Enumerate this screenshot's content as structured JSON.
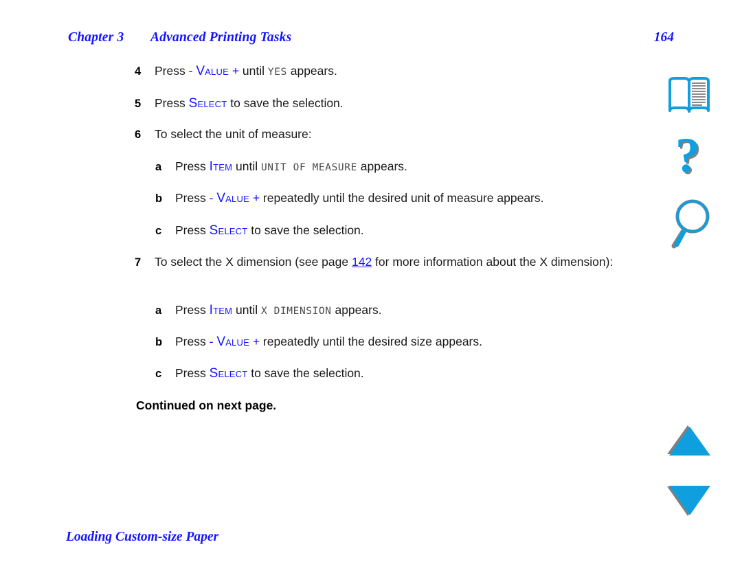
{
  "header": {
    "chapter": "Chapter 3",
    "title": "Advanced Printing Tasks",
    "page_number": "164"
  },
  "colors": {
    "link_blue": "#1414FF",
    "icon_cyan": "#109FDE",
    "icon_shadow_gray": "#808080",
    "lcd_gray": "#4a4a4a",
    "body_black": "#1a1a1a"
  },
  "steps": [
    {
      "level": 1,
      "marker": "4",
      "parts": [
        {
          "type": "text",
          "value": "Press "
        },
        {
          "type": "sign",
          "value": "- "
        },
        {
          "type": "key",
          "value": "Value"
        },
        {
          "type": "sign",
          "value": " +"
        },
        {
          "type": "text",
          "value": " until "
        },
        {
          "type": "lcd",
          "value": "YES"
        },
        {
          "type": "text",
          "value": " appears."
        }
      ]
    },
    {
      "level": 1,
      "marker": "5",
      "parts": [
        {
          "type": "text",
          "value": "Press "
        },
        {
          "type": "key",
          "value": "Select"
        },
        {
          "type": "text",
          "value": " to save the selection."
        }
      ]
    },
    {
      "level": 1,
      "marker": "6",
      "parts": [
        {
          "type": "text",
          "value": "To select the unit of measure:"
        }
      ]
    },
    {
      "level": 2,
      "marker": "a",
      "parts": [
        {
          "type": "text",
          "value": "Press "
        },
        {
          "type": "key",
          "value": "Item"
        },
        {
          "type": "text",
          "value": " until "
        },
        {
          "type": "lcd",
          "value": "UNIT OF MEASURE"
        },
        {
          "type": "text",
          "value": " appears."
        }
      ]
    },
    {
      "level": 2,
      "marker": "b",
      "parts": [
        {
          "type": "text",
          "value": "Press "
        },
        {
          "type": "sign",
          "value": "- "
        },
        {
          "type": "key",
          "value": "Value"
        },
        {
          "type": "sign",
          "value": " +"
        },
        {
          "type": "text",
          "value": " repeatedly until the desired unit of measure appears."
        }
      ]
    },
    {
      "level": 2,
      "marker": "c",
      "parts": [
        {
          "type": "text",
          "value": "Press "
        },
        {
          "type": "key",
          "value": "Select"
        },
        {
          "type": "text",
          "value": " to save the selection."
        }
      ]
    },
    {
      "level": 1,
      "marker": "7",
      "parts": [
        {
          "type": "text",
          "value": "To select the X dimension (see page "
        },
        {
          "type": "xref",
          "value": "142"
        },
        {
          "type": "text",
          "value": " for more information about the X dimension):"
        }
      ]
    },
    {
      "level": 2,
      "marker": "a",
      "parts": [
        {
          "type": "text",
          "value": "Press "
        },
        {
          "type": "key",
          "value": "Item"
        },
        {
          "type": "text",
          "value": " until "
        },
        {
          "type": "lcd",
          "value": "X DIMENSION"
        },
        {
          "type": "text",
          "value": " appears."
        }
      ]
    },
    {
      "level": 2,
      "marker": "b",
      "parts": [
        {
          "type": "text",
          "value": "Press "
        },
        {
          "type": "sign",
          "value": "- "
        },
        {
          "type": "key",
          "value": "Value"
        },
        {
          "type": "sign",
          "value": " +"
        },
        {
          "type": "text",
          "value": " repeatedly until the desired size appears."
        }
      ]
    },
    {
      "level": 2,
      "marker": "c",
      "parts": [
        {
          "type": "text",
          "value": "Press "
        },
        {
          "type": "key",
          "value": "Select"
        },
        {
          "type": "text",
          "value": " to save the selection."
        }
      ]
    }
  ],
  "continued_note": "Continued on next page.",
  "footer": {
    "section_title": "Loading Custom-size Paper"
  },
  "icon_rail": [
    {
      "name": "book-icon",
      "label": "Table of contents"
    },
    {
      "name": "question-mark-icon",
      "label": "Help"
    },
    {
      "name": "magnifier-icon",
      "label": "Search"
    },
    {
      "name": "triangle-up-icon",
      "label": "Previous page"
    },
    {
      "name": "triangle-down-icon",
      "label": "Next page"
    }
  ]
}
